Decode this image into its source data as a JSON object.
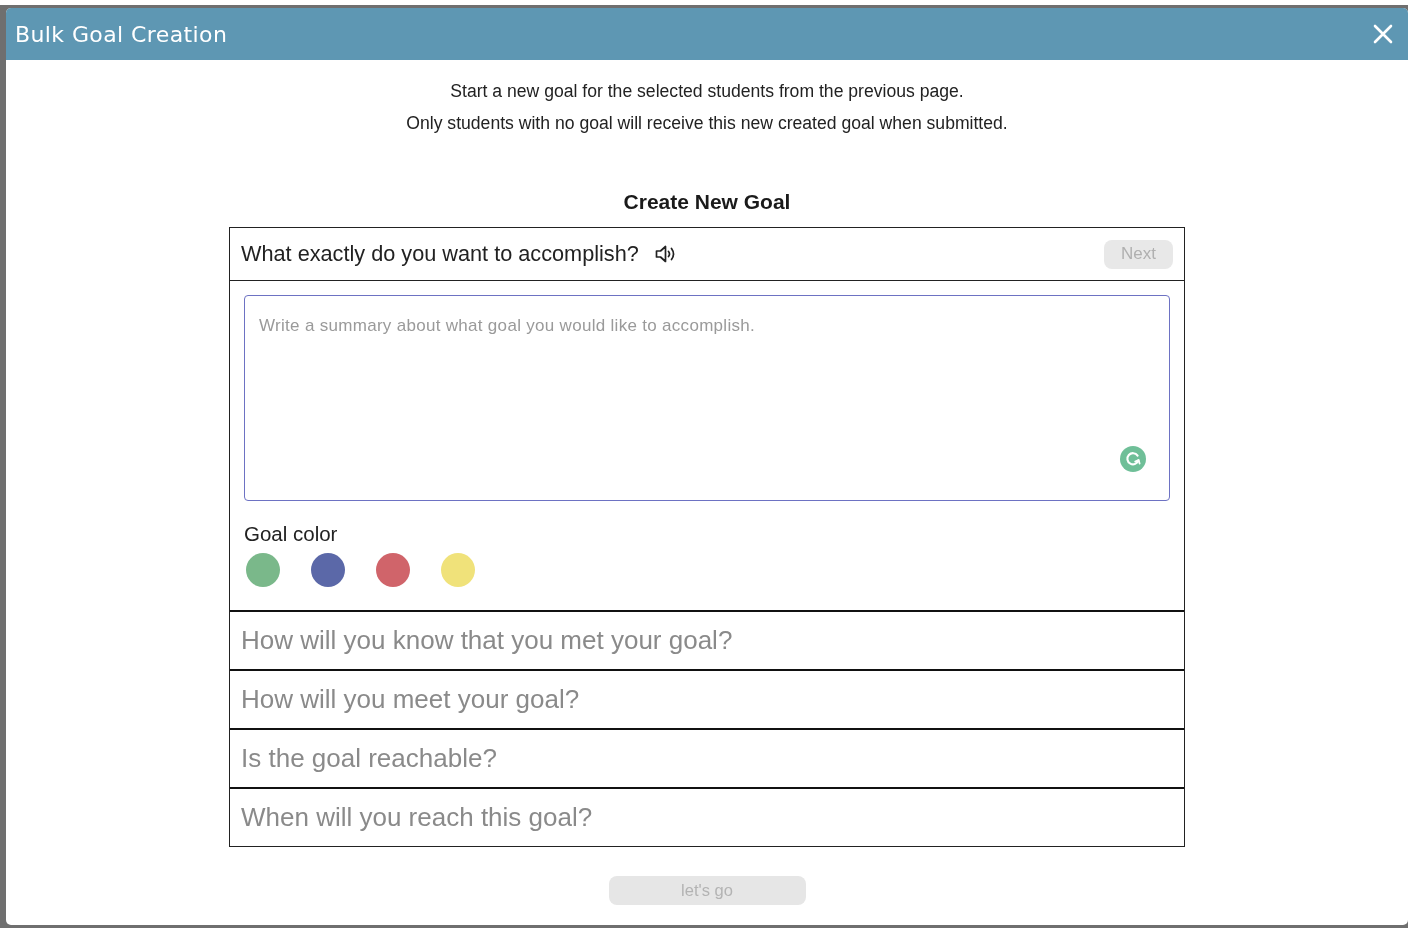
{
  "window": {
    "title": "Bulk Goal Creation"
  },
  "intro": [
    "Start a new goal for the selected students from the previous page.",
    "Only students with no goal will receive this new created goal when submitted."
  ],
  "form": {
    "title": "Create New Goal",
    "steps": [
      {
        "question": "What exactly do you want to accomplish?",
        "expanded": true,
        "next_button": {
          "label": "Next",
          "disabled": true
        },
        "summary_field": {
          "placeholder": "Write a summary about what goal you would like to accomplish.",
          "focused": true
        },
        "goal_color": {
          "label": "Goal color",
          "swatches": [
            {
              "color": "#7ab88a",
              "selected": false
            },
            {
              "color": "#5b68a8",
              "selected": false
            },
            {
              "color": "#d0646a",
              "selected": false
            },
            {
              "color": "#f0e27a",
              "selected": false
            }
          ]
        }
      },
      {
        "question": "How will you know that you met your goal?",
        "expanded": false
      },
      {
        "question": "How will you meet your goal?",
        "expanded": false
      },
      {
        "question": "Is the goal reachable?",
        "expanded": false
      },
      {
        "question": "When will you reach this goal?",
        "expanded": false
      }
    ]
  },
  "submit_button": {
    "label": "let's go",
    "disabled": true
  }
}
